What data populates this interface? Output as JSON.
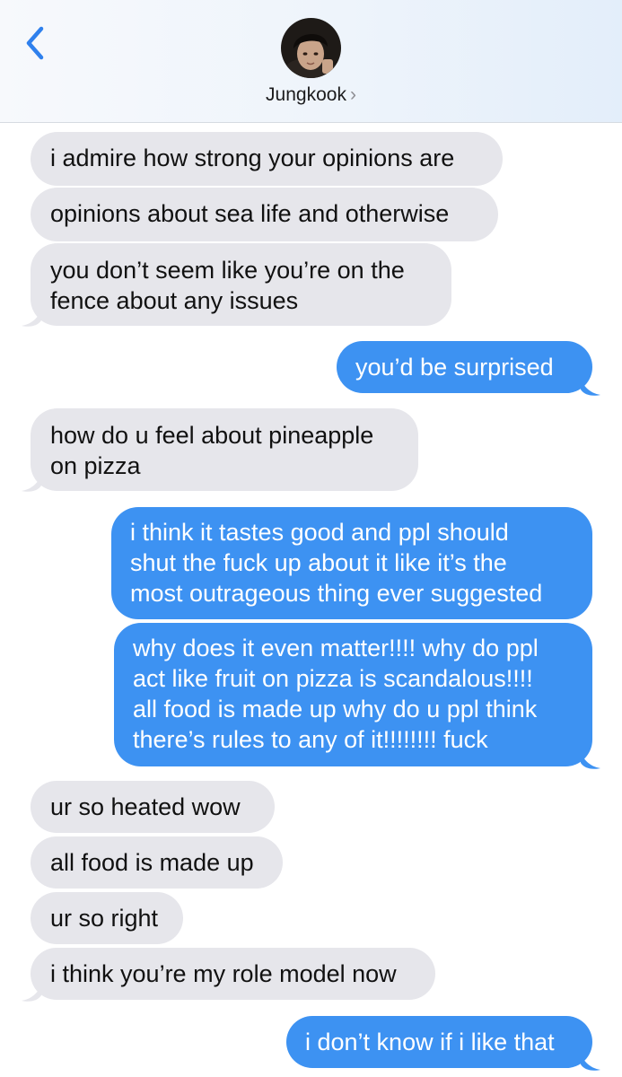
{
  "contact": {
    "name": "Jungkook",
    "chevron": "›",
    "avatar_icon": "contact-photo"
  },
  "nav": {
    "back_icon": "chevron-left-icon"
  },
  "colors": {
    "incoming_bubble": "#e6e6eb",
    "outgoing_bubble": "#3d92f2",
    "accent": "#2f80ed"
  },
  "messages": [
    {
      "from": "them",
      "text": "i admire how strong your opinions are"
    },
    {
      "from": "them",
      "text": "opinions about sea life and otherwise"
    },
    {
      "from": "them",
      "lines": [
        "you don’t seem like you’re on the",
        "fence about any issues"
      ]
    },
    {
      "from": "me",
      "text": "you’d be surprised"
    },
    {
      "from": "them",
      "lines": [
        "how do u feel about pineapple",
        "on pizza"
      ]
    },
    {
      "from": "me",
      "lines": [
        "i think it tastes good and ppl should",
        "shut the fuck up about it like it’s the",
        "most outrageous thing ever suggested"
      ]
    },
    {
      "from": "me",
      "lines": [
        "why does it even matter!!!! why do ppl",
        "act like fruit on pizza is scandalous!!!!",
        "all food is made up why do u ppl think",
        "there’s rules to any of it!!!!!!!! fuck"
      ]
    },
    {
      "from": "them",
      "text": "ur so heated wow"
    },
    {
      "from": "them",
      "text": "all food is made up"
    },
    {
      "from": "them",
      "text": "ur so right"
    },
    {
      "from": "them",
      "text": "i think you’re my role model now"
    },
    {
      "from": "me",
      "text": "i don’t know if i like that"
    }
  ]
}
